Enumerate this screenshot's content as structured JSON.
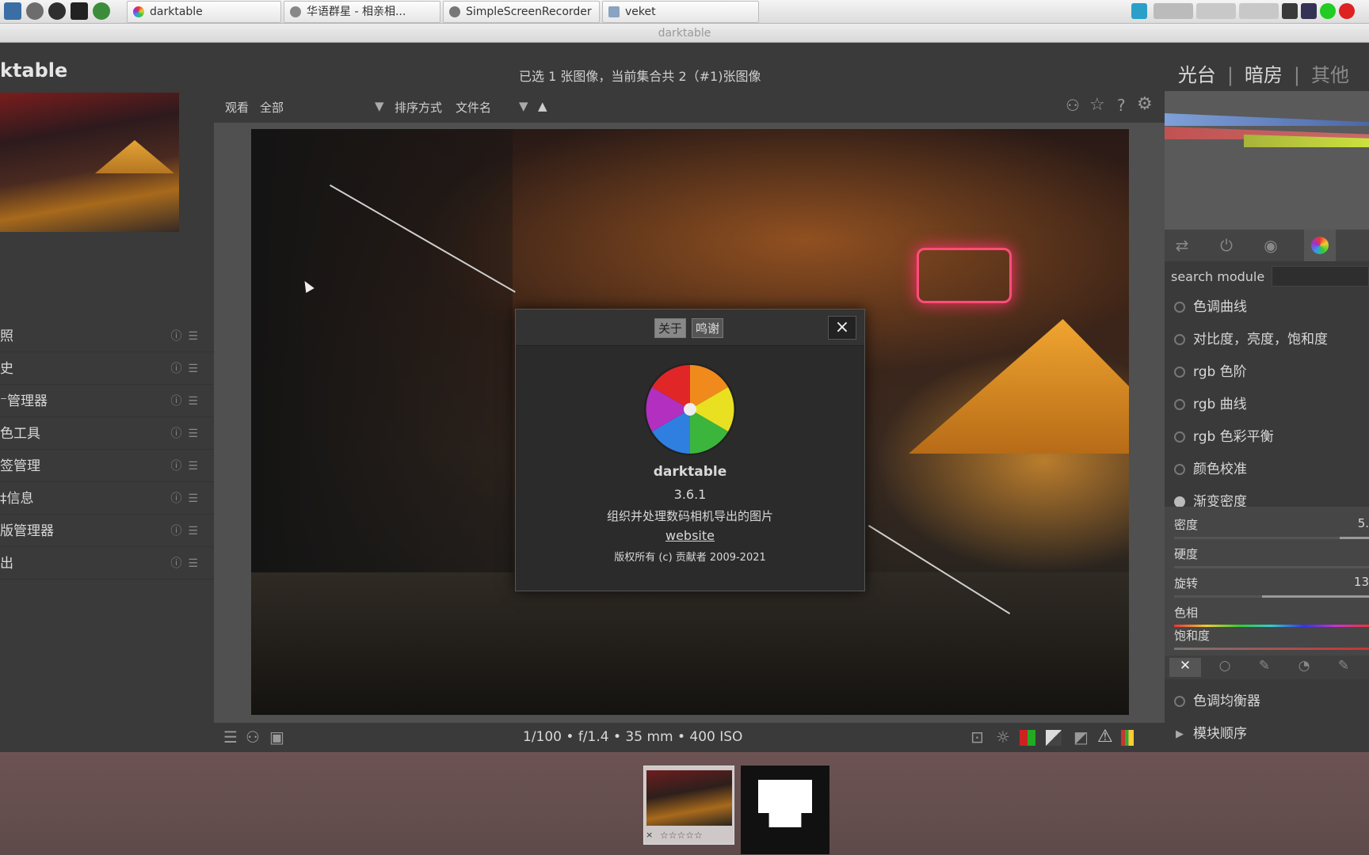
{
  "taskbar": {
    "tasks": [
      {
        "label": "darktable"
      },
      {
        "label": "华语群星 - 相亲相..."
      },
      {
        "label": "SimpleScreenRecorder"
      },
      {
        "label": "veket"
      }
    ]
  },
  "window": {
    "title": "darktable"
  },
  "header": {
    "logo": "ktable",
    "collection_info": "已选 1 张图像，当前集合共 2（#1)张图像",
    "views": {
      "lighttable": "光台",
      "sep": "|",
      "darkroom": "暗房",
      "other": "其他"
    }
  },
  "left_panel": {
    "modules": [
      {
        "label": "照"
      },
      {
        "label": "史"
      },
      {
        "label": "⁻管理器"
      },
      {
        "label": "色工具"
      },
      {
        "label": "签管理"
      },
      {
        "label": "‡信息"
      },
      {
        "label": "版管理器"
      },
      {
        "label": "出"
      }
    ]
  },
  "toolbar": {
    "view_label": "观看",
    "view_value": "全部",
    "sort_label": "排序方式",
    "sort_value": "文件名",
    "sort_dir": "▲"
  },
  "image_info": {
    "exif": "1/100 • f/1.4 • 35 mm • 400 ISO"
  },
  "right_panel": {
    "search_label": "search module",
    "modules": [
      {
        "label": "色调曲线",
        "on": false
      },
      {
        "label": "对比度，亮度，饱和度",
        "on": false
      },
      {
        "label": "rgb 色阶",
        "on": false
      },
      {
        "label": "rgb 曲线",
        "on": false
      },
      {
        "label": "rgb 色彩平衡",
        "on": false
      },
      {
        "label": "颜色校准",
        "on": false
      },
      {
        "label": "渐变密度",
        "on": true
      }
    ],
    "params": [
      {
        "label": "密度",
        "value": "5.",
        "level": 0.15
      },
      {
        "label": "硬度",
        "value": "",
        "level": 0.0
      },
      {
        "label": "旋转",
        "value": "13",
        "level": 0.55
      },
      {
        "label": "色相",
        "value": ""
      },
      {
        "label": "饱和度",
        "value": ""
      }
    ],
    "modules_after": [
      {
        "label": "色调均衡器"
      },
      {
        "label": "模块顺序"
      }
    ],
    "module_order_arrow": "▶"
  },
  "filmstrip": {
    "stars": "☆☆☆☆☆",
    "reject": "×"
  },
  "about_dialog": {
    "tab_about": "关于",
    "tab_credits": "鸣谢",
    "close": "×",
    "app_name": "darktable",
    "version": "3.6.1",
    "description": "组织并处理数码相机导出的图片",
    "website": "website",
    "copyright": "版权所有 (c) 贡献者 2009-2021"
  },
  "colors": {
    "panel_bg": "#3a3a3a",
    "center_bg": "#505050",
    "dialog_bg": "#2b2b2b"
  }
}
